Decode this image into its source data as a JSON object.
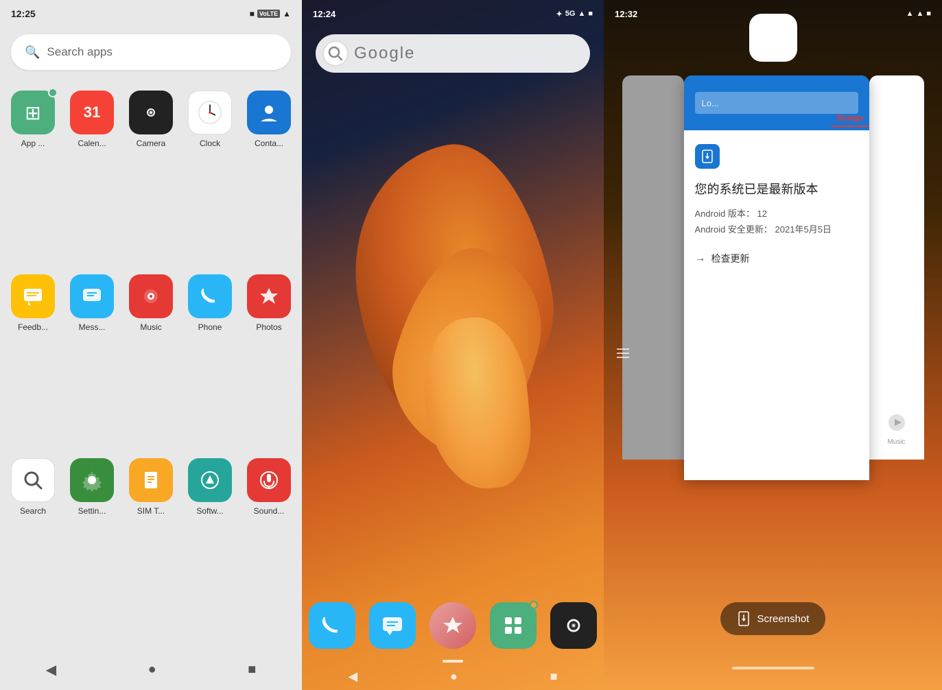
{
  "panel1": {
    "status": {
      "time": "12:25",
      "signal": "▲▼",
      "battery": "■"
    },
    "search_placeholder": "Search apps",
    "apps": [
      {
        "id": "appstore",
        "label": "App ...",
        "iconClass": "icon-appstore",
        "iconChar": "⊞"
      },
      {
        "id": "calendar",
        "label": "Calen...",
        "iconClass": "icon-calendar",
        "iconChar": "31"
      },
      {
        "id": "camera",
        "label": "Camera",
        "iconClass": "icon-camera",
        "iconChar": "●"
      },
      {
        "id": "clock",
        "label": "Clock",
        "iconClass": "icon-clock",
        "iconChar": "🕐"
      },
      {
        "id": "contacts",
        "label": "Conta...",
        "iconClass": "icon-contacts",
        "iconChar": "👤"
      },
      {
        "id": "feedback",
        "label": "Feedb...",
        "iconClass": "icon-feedback",
        "iconChar": "💬"
      },
      {
        "id": "messages",
        "label": "Mess...",
        "iconClass": "icon-messages",
        "iconChar": "💬"
      },
      {
        "id": "music",
        "label": "Music",
        "iconClass": "icon-music",
        "iconChar": "♪"
      },
      {
        "id": "phone",
        "label": "Phone",
        "iconClass": "icon-phone",
        "iconChar": "📞"
      },
      {
        "id": "photos",
        "label": "Photos",
        "iconClass": "icon-photos",
        "iconChar": "◆"
      },
      {
        "id": "search",
        "label": "Search",
        "iconClass": "icon-search",
        "iconChar": "🔍"
      },
      {
        "id": "settings",
        "label": "Settin...",
        "iconClass": "icon-settings",
        "iconChar": "⚙"
      },
      {
        "id": "simt",
        "label": "SIM T...",
        "iconClass": "icon-simt",
        "iconChar": "📋"
      },
      {
        "id": "software",
        "label": "Softw...",
        "iconClass": "icon-software",
        "iconChar": "↑"
      },
      {
        "id": "sound",
        "label": "Sound...",
        "iconClass": "icon-sound",
        "iconChar": "🔊"
      }
    ],
    "nav": {
      "back": "◀",
      "home": "●",
      "recents": "■"
    }
  },
  "panel2": {
    "status": {
      "time": "12:24",
      "battery": "■",
      "signal": "5G"
    },
    "google_placeholder": "Google",
    "dock_apps": [
      {
        "id": "phone",
        "iconClass": "dock-phone",
        "iconChar": "📞"
      },
      {
        "id": "messages",
        "iconClass": "dock-messages",
        "iconChar": "💬"
      },
      {
        "id": "photos",
        "iconClass": "dock-photos",
        "iconChar": "◆"
      },
      {
        "id": "appstore",
        "iconClass": "dock-appstore",
        "iconChar": "⊞"
      },
      {
        "id": "camera",
        "iconClass": "dock-camera",
        "iconChar": "●"
      }
    ],
    "nav": {
      "back": "◀",
      "home": "●",
      "recents": "■"
    }
  },
  "panel3": {
    "status": {
      "time": "12:32",
      "battery": "■",
      "signal": "▲"
    },
    "system_update": {
      "title": "您的系统已是最新版本",
      "android_version_label": "Android 版本：",
      "android_version": "12",
      "security_update_label": "Android 安全更新：",
      "security_update": "2021年5月5日",
      "check_update": "检查更新"
    },
    "songs_tab": "Songs",
    "search_placeholder": "Lo...",
    "screenshot_label": "Screenshot",
    "music_label": "Music"
  }
}
